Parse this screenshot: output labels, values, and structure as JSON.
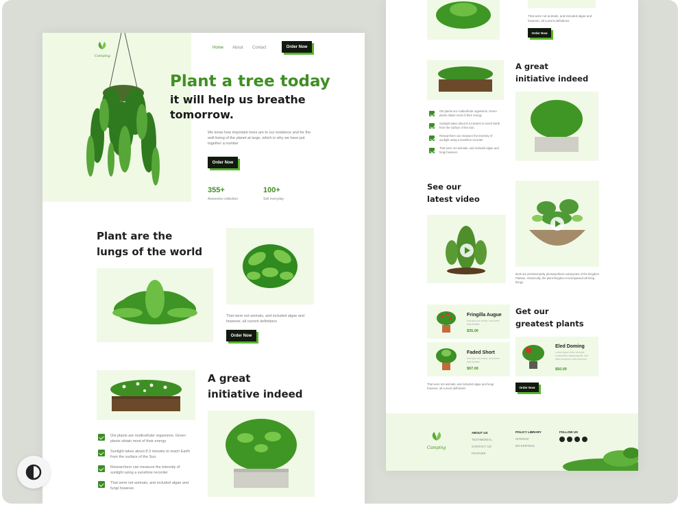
{
  "brand": {
    "logo_text": "Camping"
  },
  "nav": {
    "items": [
      "Home",
      "About",
      "Contact"
    ],
    "cta": "Order Now"
  },
  "hero": {
    "title": "Plant a tree today",
    "subtitle_line1": "it will help us breathe",
    "subtitle_line2": "tomorrow.",
    "description": "We know how important trees are to our existence and for the well-being of the planet at large, which is why we have put together a number",
    "cta": "Order Now",
    "stats": [
      {
        "value": "355+",
        "label": "Awesome collection"
      },
      {
        "value": "100+",
        "label": "Sell everyday"
      }
    ]
  },
  "lungs": {
    "title_line1": "Plant are the",
    "title_line2": "lungs of the world",
    "description": "That were not animals, and included algae and however, all current definitions",
    "cta": "Order Now"
  },
  "initiative": {
    "title_line1": "A great",
    "title_line2": "initiative indeed",
    "items": [
      "Ost plants are multicellular organisms. Green plants obtain most of their energy",
      "Sunlight takes about 8.3 minutes to reach Earth from the surface of the Sun.",
      "Researchers can measure the intensity of sunlight using a sunshine recorder",
      "That were not animals, and included algae and fungi however."
    ]
  },
  "right_top": {
    "description": "That were not animals, and included algae and however, all current definitions",
    "cta": "Order Now"
  },
  "video": {
    "title_line1": "See our",
    "title_line2": "latest video",
    "description": "lants are predominantly photosynthetic eukaryotes of the kingdom Plantae. Historically, the plant kingdom encompassed all living things"
  },
  "products": {
    "title_line1": "Get our",
    "title_line2": "greatest plants",
    "items": [
      {
        "name": "Fringilla Augue",
        "desc": "Erat quis vel ornare, sed lorem duis facilisis",
        "price": "$35.00"
      },
      {
        "name": "Faded Short",
        "desc": "Erat quis vel ornare, sed lorem duis facilisis",
        "price": "$97.00"
      },
      {
        "name": "Eled Doming",
        "desc": "Lorem ipsum dolor sit amet, consectetur adipiscing elit, sed diam nonummy nibh euismod",
        "price": "$50.00"
      }
    ],
    "note": "That were not animals, and included algae and fungi however, all current definitions",
    "cta": "Order Now"
  },
  "footer": {
    "logo_text": "Camping",
    "col1": {
      "heading": "ABOUT US",
      "links": [
        "TESTIMONIAL",
        "CONTACT US",
        "FEATURE"
      ]
    },
    "col2": {
      "heading": "POLICY LIBRARY",
      "links": [
        "SITEMAP",
        "EN ESPANOL"
      ]
    },
    "col3": {
      "heading": "FOLLOW US"
    }
  },
  "colors": {
    "accent": "#3f8f24",
    "button": "#121a0f",
    "tile": "#f0f9e6",
    "backdrop": "#d9ddd6"
  },
  "icons": [
    "checkmark-icon",
    "play-icon",
    "contrast-icon",
    "social-icon"
  ]
}
